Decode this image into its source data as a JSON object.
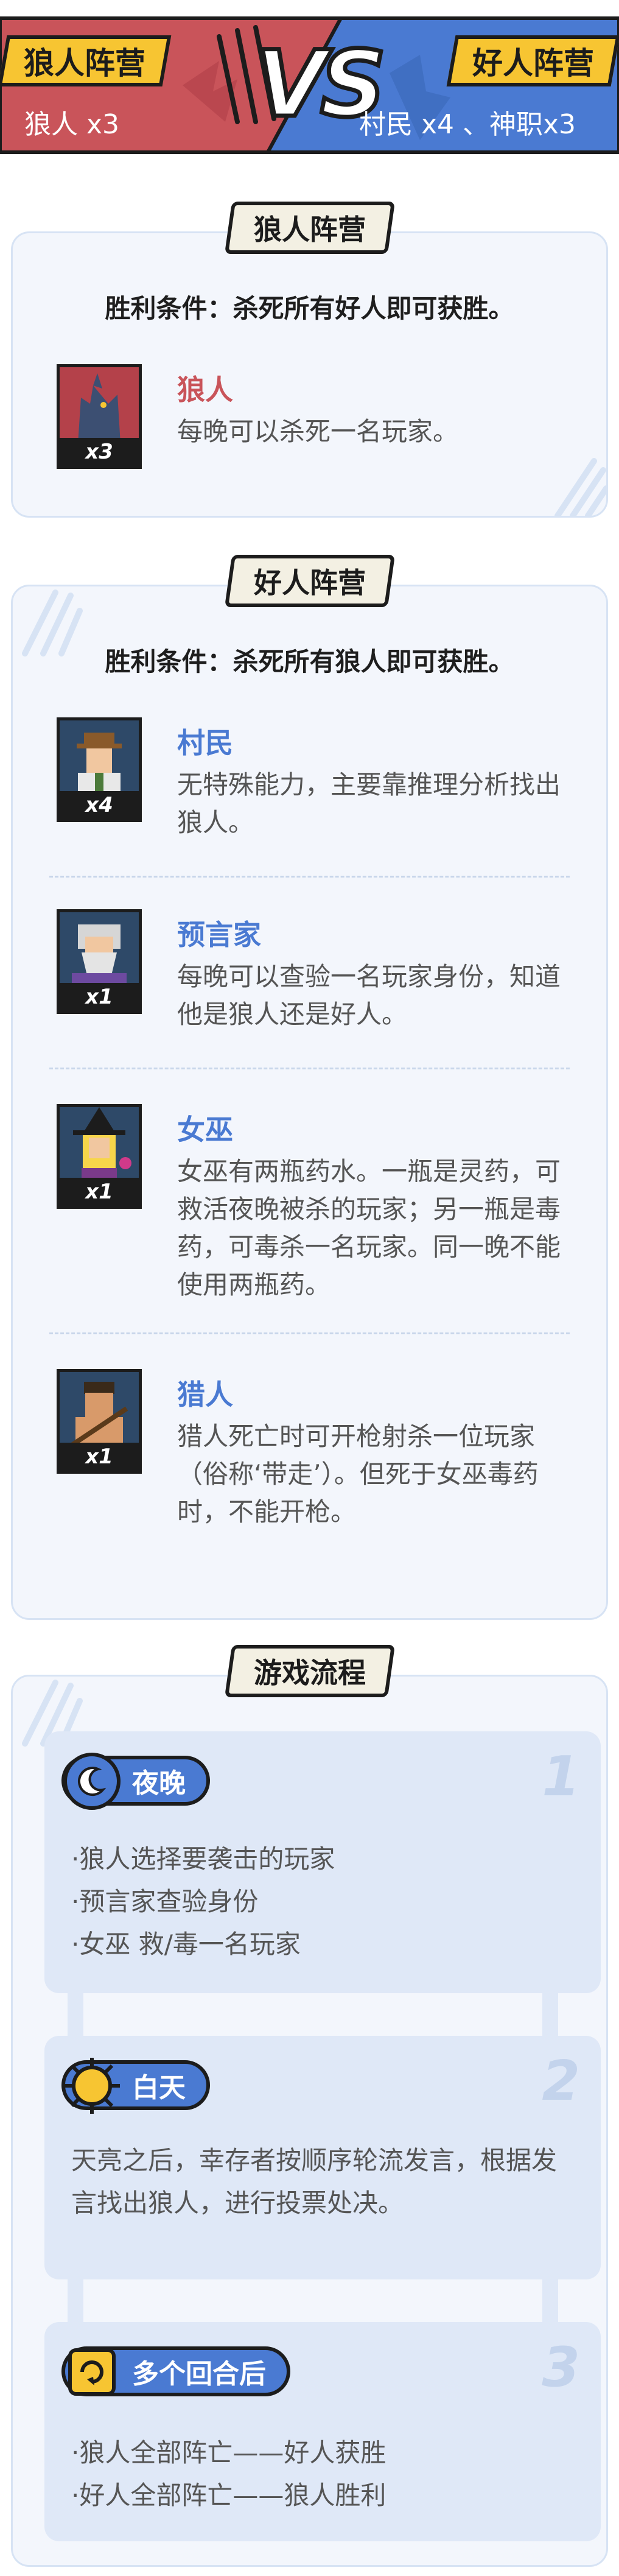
{
  "header": {
    "left_team": "狼人阵营",
    "left_count": "狼人 x3",
    "vs": "VS",
    "right_team": "好人阵营",
    "right_count": "村民 x4 、神职x3",
    "colors": {
      "left": "#c9545a",
      "right": "#4a7ad2",
      "badge": "#f7c532"
    }
  },
  "wolf_section": {
    "title": "狼人阵营",
    "win_condition": "胜利条件：杀死所有好人即可获胜。",
    "roles": [
      {
        "name": "狼人",
        "desc": "每晚可以杀死一名玩家。",
        "count": "x3",
        "icon": "wolf-icon",
        "color": "#c9545a"
      }
    ]
  },
  "good_section": {
    "title": "好人阵营",
    "win_condition": "胜利条件：杀死所有狼人即可获胜。",
    "roles": [
      {
        "name": "村民",
        "desc": "无特殊能力，主要靠推理分析找出狼人。",
        "count": "x4",
        "icon": "villager-icon",
        "color": "#4a7ad2"
      },
      {
        "name": "预言家",
        "desc": "每晚可以查验一名玩家身份，知道他是狼人还是好人。",
        "count": "x1",
        "icon": "seer-icon",
        "color": "#4a7ad2"
      },
      {
        "name": "女巫",
        "desc": "女巫有两瓶药水。一瓶是灵药，可救活夜晚被杀的玩家；另一瓶是毒药，可毒杀一名玩家。同一晚不能使用两瓶药。",
        "count": "x1",
        "icon": "witch-icon",
        "color": "#4a7ad2"
      },
      {
        "name": "猎人",
        "desc": "猎人死亡时可开枪射杀一位玩家（俗称‘带走’）。但死于女巫毒药时，不能开枪。",
        "count": "x1",
        "icon": "hunter-icon",
        "color": "#4a7ad2"
      }
    ]
  },
  "flow_section": {
    "title": "游戏流程",
    "steps": [
      {
        "num": "1",
        "label": "夜晚",
        "icon": "moon-icon",
        "lines": [
          "·狼人选择要袭击的玩家",
          "·预言家查验身份",
          "·女巫 救/毒一名玩家"
        ]
      },
      {
        "num": "2",
        "label": "白天",
        "icon": "sun-icon",
        "text": "天亮之后，幸存者按顺序轮流发言，根据发言找出狼人，进行投票处决。"
      },
      {
        "num": "3",
        "label": "多个回合后",
        "icon": "scroll-icon",
        "lines": [
          "·狼人全部阵亡——好人获胜",
          "·好人全部阵亡——狼人胜利"
        ]
      }
    ]
  }
}
